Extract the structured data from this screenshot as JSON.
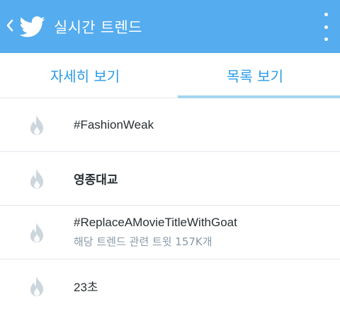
{
  "colors": {
    "header_bg": "#55acee",
    "tab_text": "#2a9be8",
    "tab_indicator": "#a4d4ee",
    "divider": "#e1e8ed",
    "flame_icon": "#ccd6dd",
    "trend_text": "#292f33",
    "sub_text": "#8899a6"
  },
  "header": {
    "back_icon": "chevron-left-icon",
    "logo_icon": "twitter-bird-icon",
    "title": "실시간 트렌드",
    "menu_icon": "more-vertical-icon"
  },
  "tabs": [
    {
      "label": "자세히 보기",
      "active": false
    },
    {
      "label": "목록 보기",
      "active": true
    }
  ],
  "trends": [
    {
      "name": "#FashionWeak",
      "bold": false,
      "sub": ""
    },
    {
      "name": "영종대교",
      "bold": true,
      "sub": ""
    },
    {
      "name": "#ReplaceAMovieTitleWithGoat",
      "bold": false,
      "sub": "해당 트렌드 관련 트윗 157K개"
    },
    {
      "name": "23초",
      "bold": false,
      "sub": ""
    }
  ]
}
